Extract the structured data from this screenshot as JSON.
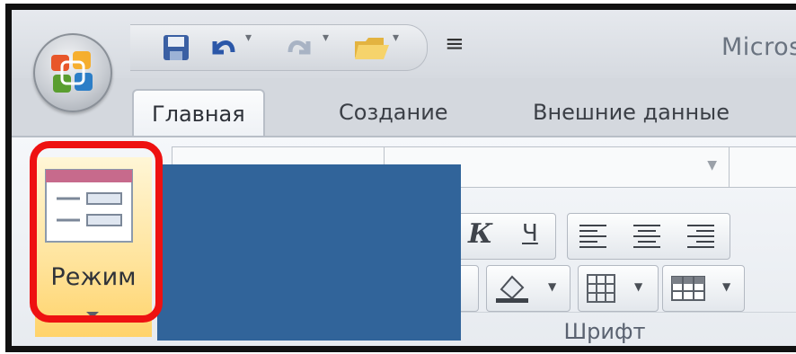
{
  "window": {
    "title": "Microsoft"
  },
  "qat": {
    "items": [
      {
        "icon": "save-icon"
      },
      {
        "icon": "undo-icon"
      },
      {
        "icon": "redo-icon"
      },
      {
        "icon": "open-folder-icon"
      },
      {
        "icon": "customize-qat-icon",
        "glyph": "≡"
      }
    ]
  },
  "tabs": [
    {
      "label": "Главная",
      "active": true
    },
    {
      "label": "Создание",
      "active": false
    },
    {
      "label": "Внешние данные",
      "active": false
    }
  ],
  "ribbon": {
    "view_button": {
      "label": "Режим",
      "icon": "form-view-icon"
    },
    "font_group_label": "Шрифт",
    "format_buttons": [
      {
        "glyph": "К",
        "icon": "italic-icon"
      },
      {
        "glyph": "Ч",
        "icon": "underline-icon"
      }
    ],
    "align_buttons": [
      {
        "icon": "align-left-icon"
      },
      {
        "icon": "align-center-icon"
      },
      {
        "icon": "align-right-icon"
      }
    ],
    "misc_buttons": [
      {
        "icon": "fill-color-icon"
      },
      {
        "icon": "gridlines-icon"
      },
      {
        "icon": "alternate-row-color-icon"
      }
    ]
  },
  "colors": {
    "highlight": "#ee1111",
    "overlay_blue": "#31649a",
    "active_button": "#ffd36a"
  }
}
